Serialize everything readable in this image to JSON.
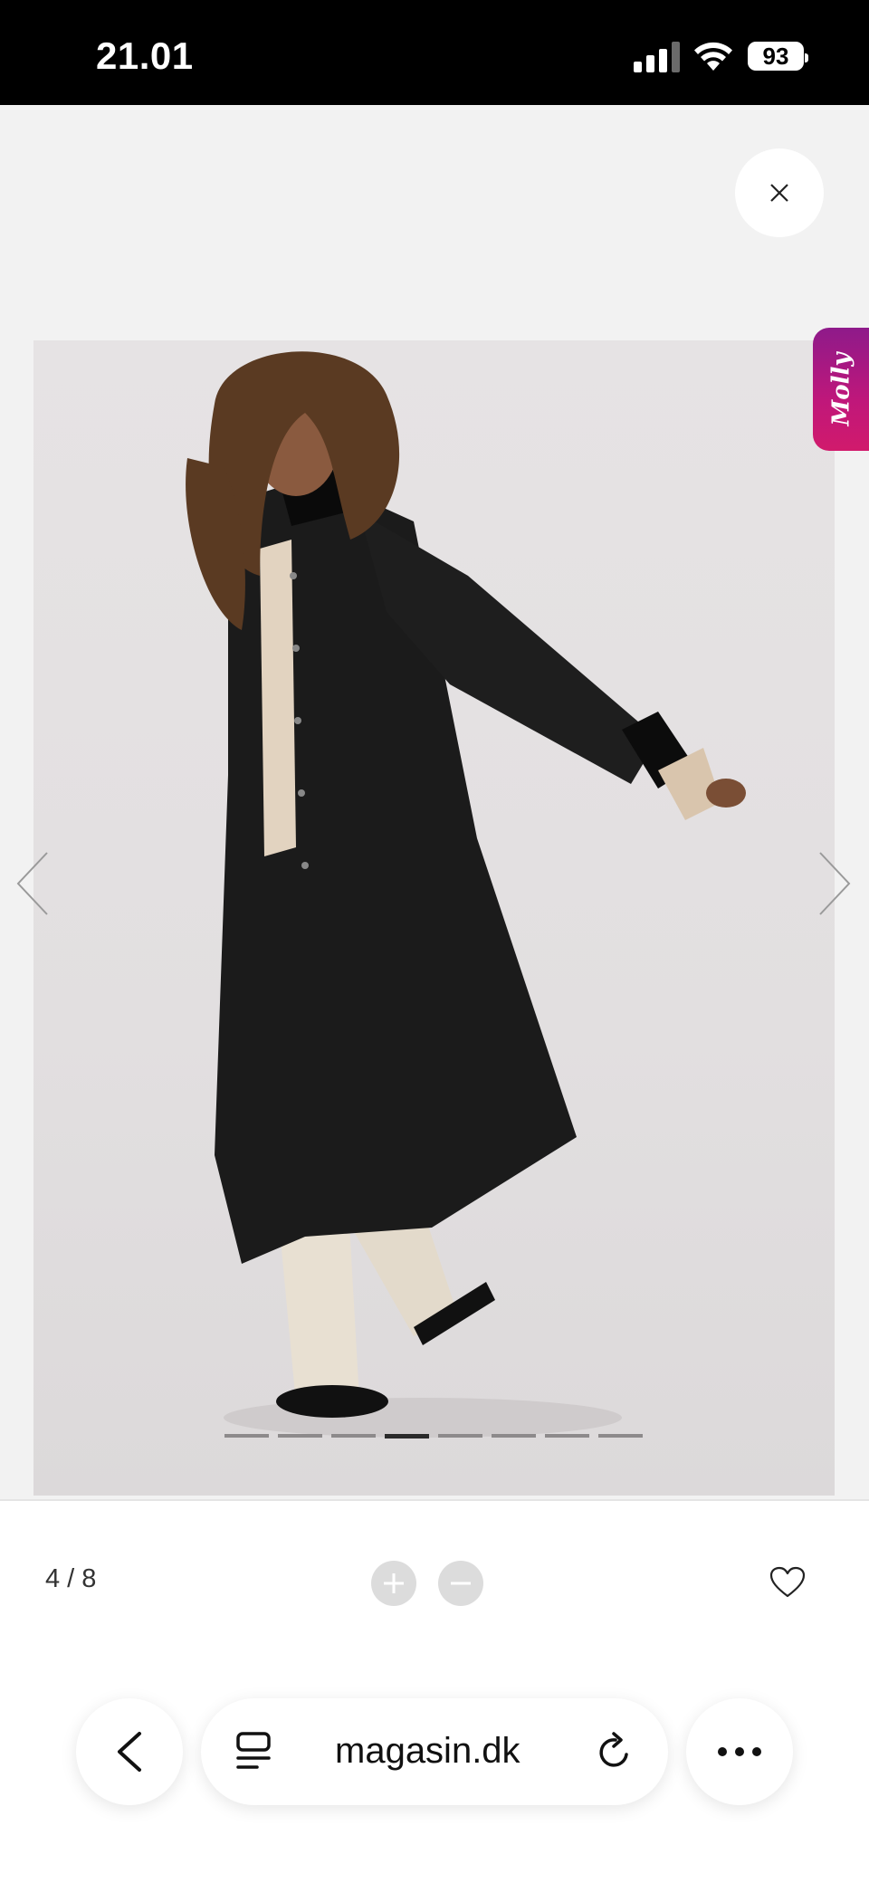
{
  "status_bar": {
    "time": "21.01",
    "battery": "93"
  },
  "overlay": {
    "close_icon": "close-icon",
    "chat_tab": {
      "label": "Molly",
      "colors": [
        "#8e1a8a",
        "#d11a6c"
      ]
    }
  },
  "gallery": {
    "current": 4,
    "total": 8,
    "counter_text": "4 / 8",
    "dots_count": 8,
    "active_dot": 4,
    "image_alt": "product-photo-black-long-coat"
  },
  "controls": {
    "zoom_in_icon": "plus-icon",
    "zoom_out_icon": "minus-icon",
    "favorite_icon": "heart-icon"
  },
  "browser": {
    "url": "magasin.dk",
    "back_icon": "chevron-left-icon",
    "reader_icon": "reader-icon",
    "reload_icon": "reload-icon",
    "more_icon": "ellipsis-icon"
  }
}
